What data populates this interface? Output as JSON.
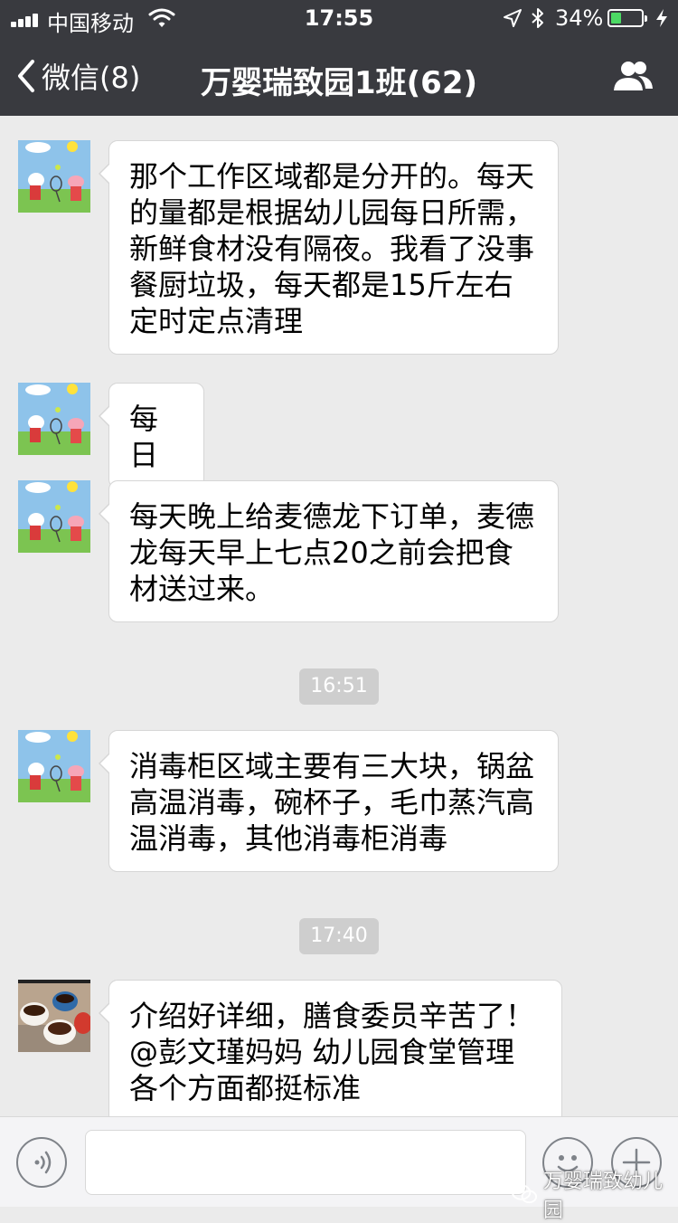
{
  "status_bar": {
    "carrier": "中国移动",
    "time": "17:55",
    "battery_percent": "34%",
    "battery_level": 0.34,
    "signal_icon": "signal-bars-icon",
    "wifi_icon": "wifi-icon",
    "location_icon": "location-arrow-icon",
    "bluetooth_icon": "bluetooth-icon",
    "charging_icon": "charging-bolt-icon",
    "battery_color": "#4cd964"
  },
  "nav": {
    "back_label": "微信(8)",
    "title": "万婴瑞致园1班(62)",
    "members_icon": "group-members-icon",
    "background": "#393a3f"
  },
  "messages": [
    {
      "avatar": "peppa-pig-avatar",
      "text": "那个工作区域都是分开的。每天的量都是根据幼儿园每日所需，新鲜食材没有隔夜。我看了没事餐厨垃圾，每天都是15斤左右定时定点清理"
    },
    {
      "avatar": "peppa-pig-avatar",
      "text": "每日"
    },
    {
      "avatar": "peppa-pig-avatar",
      "text": "每天晚上给麦德龙下订单，麦德龙每天早上七点20之前会把食材送过来。"
    },
    {
      "timestamp": "16:51"
    },
    {
      "avatar": "peppa-pig-avatar",
      "text": "消毒柜区域主要有三大块，锅盆高温消毒，碗杯子，毛巾蒸汽高温消毒，其他消毒柜消毒"
    },
    {
      "timestamp": "17:40"
    },
    {
      "avatar": "coffee-cups-avatar",
      "text": "介绍好详细，膳食委员辛苦了！@彭文瑾妈妈 幼儿园食堂管理各个方面都挺标准"
    }
  ],
  "input_bar": {
    "voice_icon": "voice-icon",
    "emoji_icon": "emoji-icon",
    "plus_icon": "plus-icon",
    "input_value": ""
  },
  "watermark": {
    "icon": "wechat-official-account-icon",
    "text": "万婴瑞致幼儿园"
  }
}
